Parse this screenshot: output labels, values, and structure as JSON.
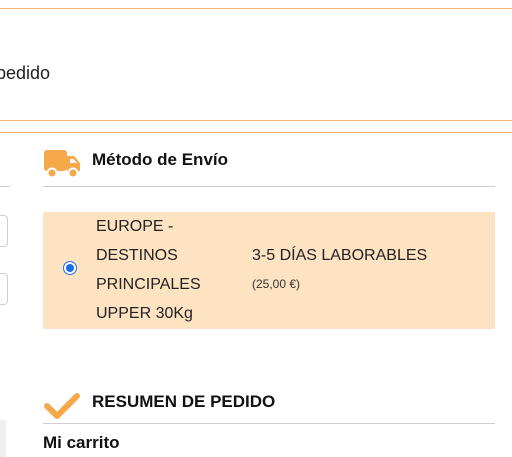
{
  "top_panel": {
    "label": "pedido"
  },
  "shipping": {
    "title": "Método de Envío",
    "option": {
      "name_lines": [
        "EUROPE -",
        "DESTINOS",
        "PRINCIPALES",
        "UPPER 30Kg"
      ],
      "delivery": "3-5 DÍAS LABORABLES",
      "price": "(25,00 €)",
      "selected": true
    }
  },
  "summary": {
    "title": "RESUMEN DE PEDIDO",
    "cart_label": "Mi carrito"
  },
  "colors": {
    "accent": "#f5a94b",
    "option_bg": "#fde3c2",
    "panel_border": "#f1b46a",
    "radio": "#1a6fe0"
  },
  "icons": {
    "shipping": "truck-icon",
    "summary": "checkmark-icon"
  }
}
